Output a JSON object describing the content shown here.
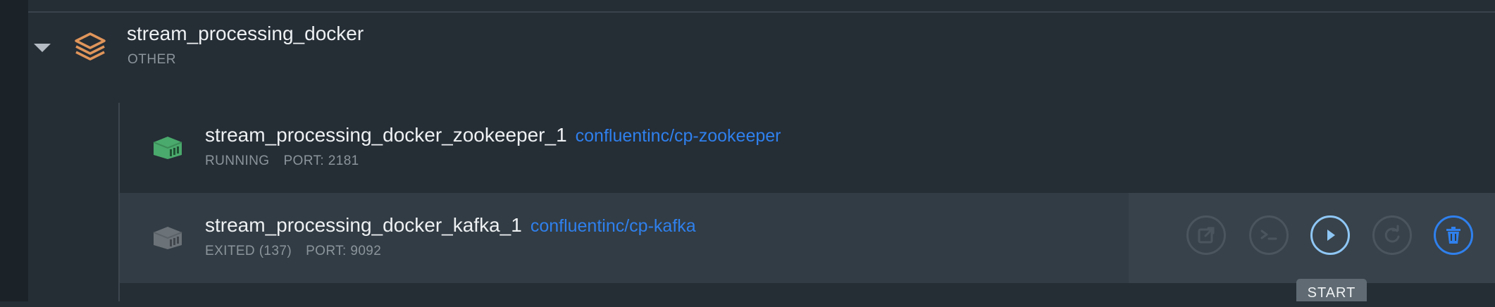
{
  "group": {
    "name": "stream_processing_docker",
    "type": "OTHER"
  },
  "containers": [
    {
      "name": "stream_processing_docker_zookeeper_1",
      "image": "confluentinc/cp-zookeeper",
      "status": "RUNNING",
      "port": "PORT: 2181",
      "status_color": "#4aa96c"
    },
    {
      "name": "stream_processing_docker_kafka_1",
      "image": "confluentinc/cp-kafka",
      "status": "EXITED (137)",
      "port": "PORT: 9092",
      "status_color": "#6b7278"
    }
  ],
  "actions": [
    {
      "name": "open-in-browser",
      "icon": "external-link-icon"
    },
    {
      "name": "cli",
      "icon": "terminal-icon"
    },
    {
      "name": "start",
      "icon": "play-icon"
    },
    {
      "name": "restart",
      "icon": "restart-icon"
    },
    {
      "name": "remove",
      "icon": "trash-icon"
    }
  ],
  "tooltip": {
    "label": "START"
  },
  "colors": {
    "accent": "#2f80ed",
    "stack_icon": "#e0955a",
    "background": "#252d35"
  }
}
